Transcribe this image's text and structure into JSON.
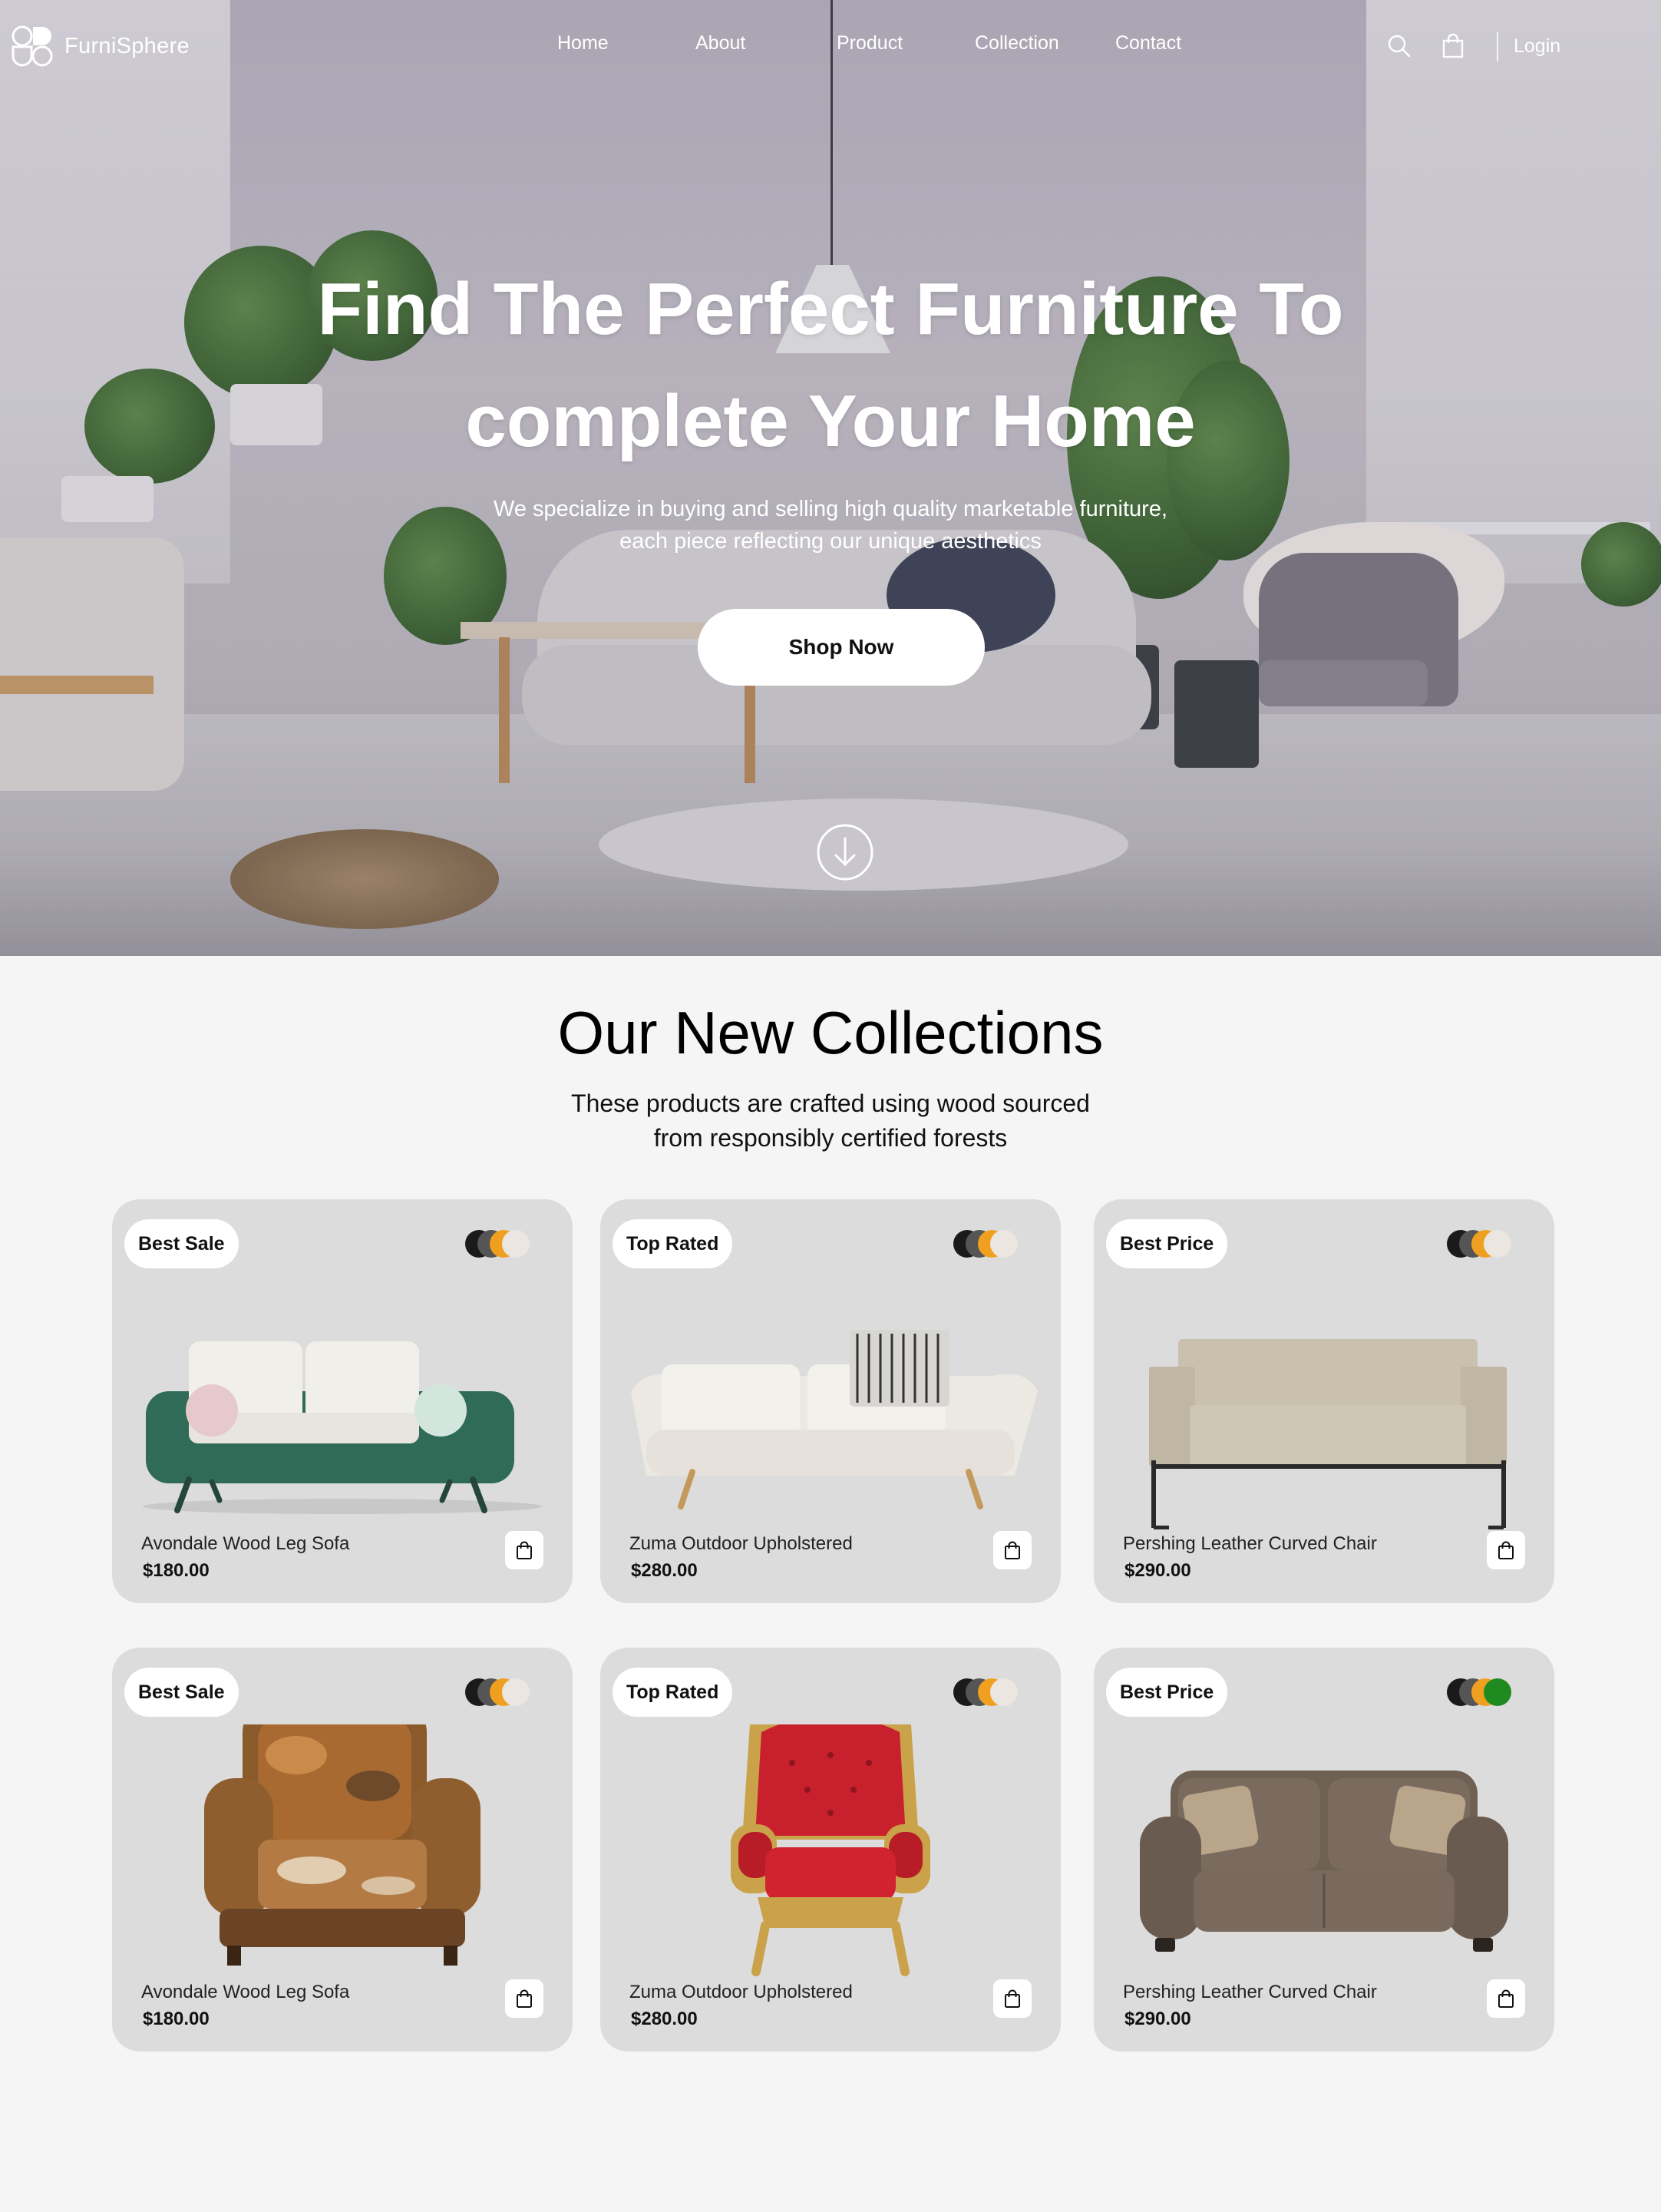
{
  "brand": {
    "name": "FurniSphere"
  },
  "nav": {
    "links": [
      "Home",
      "About",
      "Product",
      "Collection",
      "Contact"
    ],
    "login_label": "Login",
    "icons": [
      "search-icon",
      "shopping-bag-icon"
    ]
  },
  "hero": {
    "title_line1": "Find The Perfect Furniture To",
    "title_line2": "complete Your Home",
    "subtitle_line1": "We specialize in buying and selling high quality marketable furniture,",
    "subtitle_line2": "each piece reflecting our unique aesthetics",
    "cta_label": "Shop Now",
    "scroll_icon": "arrow-down-circle-icon"
  },
  "collections": {
    "title": "Our New Collections",
    "subtitle_line1": "These products are crafted using wood sourced",
    "subtitle_line2": "from responsibly certified forests",
    "products": [
      {
        "badge": "Best Sale",
        "name": "Avondale Wood Leg Sofa",
        "price": "$180.00",
        "swatches": [
          "#1a1a1a",
          "#555555",
          "#f0a020",
          "#ebe7e0"
        ]
      },
      {
        "badge": "Top Rated",
        "name": "Zuma Outdoor Upholstered",
        "price": "$280.00",
        "swatches": [
          "#1a1a1a",
          "#555555",
          "#f0a020",
          "#ebe7e0"
        ]
      },
      {
        "badge": "Best Price",
        "name": "Pershing Leather Curved Chair",
        "price": "$290.00",
        "swatches": [
          "#1a1a1a",
          "#555555",
          "#f0a020",
          "#ebe7e0"
        ]
      },
      {
        "badge": "Best Sale",
        "name": "Avondale Wood Leg Sofa",
        "price": "$180.00",
        "swatches": [
          "#1a1a1a",
          "#555555",
          "#f0a020",
          "#ebe7e0"
        ]
      },
      {
        "badge": "Top Rated",
        "name": "Zuma Outdoor Upholstered",
        "price": "$280.00",
        "swatches": [
          "#1a1a1a",
          "#555555",
          "#f0a020",
          "#ebe7e0"
        ]
      },
      {
        "badge": "Best Price",
        "name": "Pershing Leather Curved Chair",
        "price": "$290.00",
        "swatches": [
          "#1a1a1a",
          "#555555",
          "#f0a020",
          "#1f8a1f"
        ]
      }
    ]
  },
  "colors": {
    "page_bg": "#f5f5f5",
    "card_bg": "#dcdcdc",
    "accent": "#f0a020"
  }
}
